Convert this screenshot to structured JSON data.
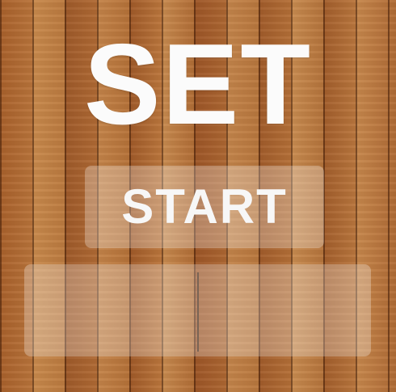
{
  "app": {
    "title": "SET"
  },
  "start_button": {
    "label": "START"
  },
  "input_panel": {
    "value": ""
  }
}
